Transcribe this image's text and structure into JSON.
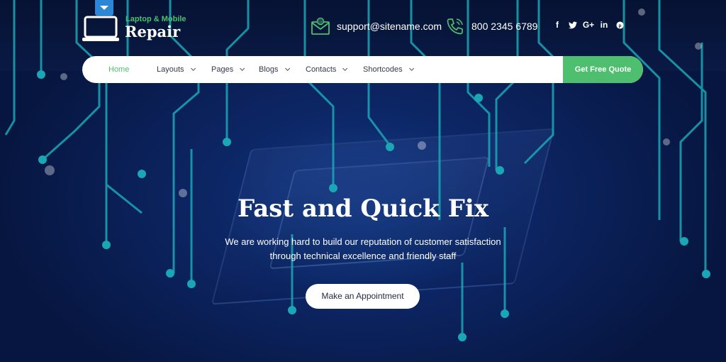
{
  "brand": {
    "tagline": "Laptop & Mobile",
    "name": "Repair",
    "icon": "laptop-icon"
  },
  "contact": {
    "email": "support@sitename.com",
    "email_icon": "envelope-icon",
    "phone": "800 2345 6789",
    "phone_icon": "phone-icon"
  },
  "social": [
    {
      "icon": "facebook-icon",
      "glyph": "f"
    },
    {
      "icon": "twitter-icon",
      "glyph": "t"
    },
    {
      "icon": "google-plus-icon",
      "glyph": "G+"
    },
    {
      "icon": "linkedin-icon",
      "glyph": "in"
    },
    {
      "icon": "pinterest-icon",
      "glyph": "p"
    }
  ],
  "nav": {
    "items": [
      {
        "label": "Home",
        "active": true
      },
      {
        "label": "Layouts",
        "dropdown": true
      },
      {
        "label": "Pages",
        "dropdown": true
      },
      {
        "label": "Blogs",
        "dropdown": true
      },
      {
        "label": "Contacts",
        "dropdown": true
      },
      {
        "label": "Shortcodes",
        "dropdown": true
      }
    ],
    "cta": "Get Free Quote"
  },
  "hero": {
    "title": "Fast and Quick Fix",
    "text": "We are working hard to build our reputation of customer satisfaction through technical excellence and friendly staff",
    "button": "Make an Appointment"
  },
  "colors": {
    "accent": "#4dbf6e",
    "background": "#0c2563",
    "circuit": "#1aa6b5"
  }
}
